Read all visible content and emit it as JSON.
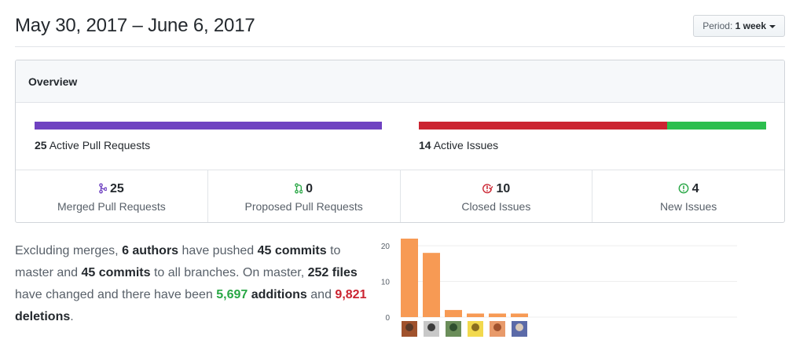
{
  "header": {
    "date_range": "May 30, 2017 – June 6, 2017",
    "period_prefix": "Period:",
    "period_value": "1 week"
  },
  "overview": {
    "title": "Overview",
    "pull_requests": {
      "count": "25",
      "label": "Active Pull Requests",
      "segments": [
        {
          "value": 25,
          "color": "#6f42c1"
        },
        {
          "value": 0,
          "color": "#28a745"
        }
      ]
    },
    "issues": {
      "count": "14",
      "label": "Active Issues",
      "segments": [
        {
          "value": 10,
          "color": "#cb2431"
        },
        {
          "value": 4,
          "color": "#2cbe4e"
        }
      ]
    },
    "stats": [
      {
        "value": "25",
        "label": "Merged Pull Requests",
        "icon": "git-merge-icon",
        "color": "#6f42c1"
      },
      {
        "value": "0",
        "label": "Proposed Pull Requests",
        "icon": "git-pull-request-icon",
        "color": "#28a745"
      },
      {
        "value": "10",
        "label": "Closed Issues",
        "icon": "issue-closed-icon",
        "color": "#cb2431"
      },
      {
        "value": "4",
        "label": "New Issues",
        "icon": "issue-opened-icon",
        "color": "#28a745"
      }
    ]
  },
  "summary": {
    "t1": "Excluding merges, ",
    "authors": "6 authors",
    "t2": " have pushed ",
    "commits_master": "45 commits",
    "t3": " to master and ",
    "commits_all": "45 commits",
    "t4": " to all branches. On master, ",
    "files": "252 files",
    "t5": " have changed and there have been ",
    "additions_num": "5,697",
    "additions_word": " additions",
    "t6": " and ",
    "deletions_num": "9,821",
    "deletions_word": " deletions",
    "t7": "."
  },
  "chart_data": {
    "type": "bar",
    "categories": [
      "author-1",
      "author-2",
      "author-3",
      "author-4",
      "author-5",
      "author-6"
    ],
    "values": [
      22,
      18,
      2,
      1,
      1,
      1
    ],
    "ylim": [
      0,
      22
    ],
    "yticks": [
      "0",
      "10",
      "20"
    ],
    "bar_color": "#f79a54",
    "grid": true
  }
}
